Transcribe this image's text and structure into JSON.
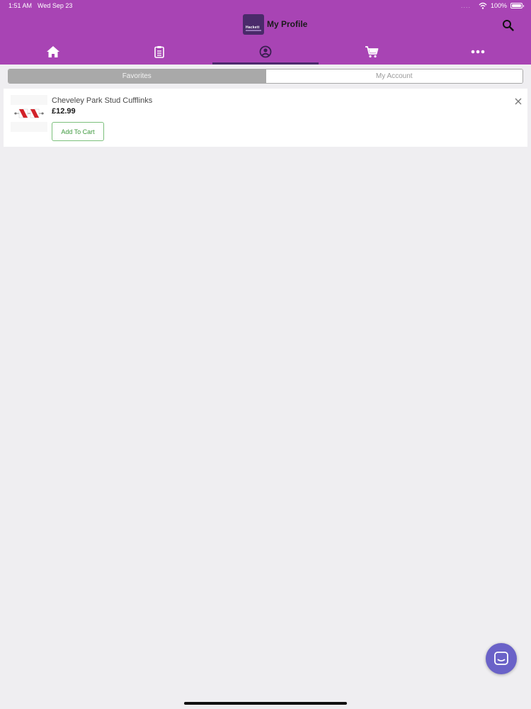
{
  "status_bar": {
    "time": "1:51 AM",
    "date": "Wed Sep 23",
    "battery": "100%"
  },
  "header": {
    "title": "My Profile",
    "logo_text": "Hackett"
  },
  "tabs": [
    {
      "icon": "home-icon",
      "active": false
    },
    {
      "icon": "clipboard-icon",
      "active": false
    },
    {
      "icon": "profile-icon",
      "active": true
    },
    {
      "icon": "cart-icon",
      "active": false
    },
    {
      "icon": "more-icon",
      "active": false
    }
  ],
  "segments": {
    "favorites": "Favorites",
    "my_account": "My Account",
    "selected": "Favorites"
  },
  "favorites": [
    {
      "name": "Cheveley Park Stud Cufflinks",
      "price": "£12.99",
      "add_to_cart_label": "Add To Cart"
    }
  ],
  "colors": {
    "header": "#a844b4",
    "tab_indicator": "#4d2a6e",
    "add_to_cart_border": "#7cc07c",
    "chat_button": "#6a62c8",
    "background": "#efeef1"
  }
}
